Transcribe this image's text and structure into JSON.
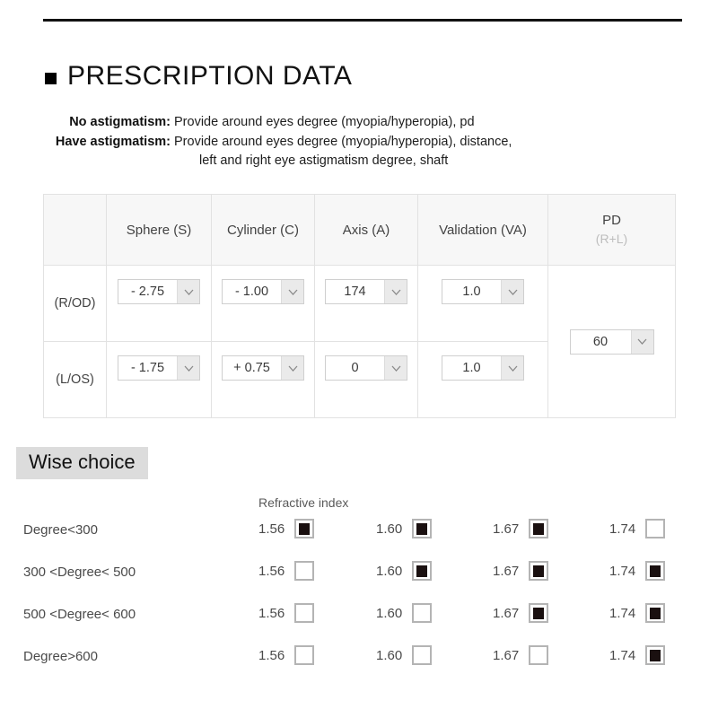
{
  "header": {
    "rule": true,
    "title": "PRESCRIPTION DATA",
    "bullet_icon": "black-square-bullet"
  },
  "notes": [
    {
      "label": "No astigmatism:",
      "line1": "Provide around eyes degree (myopia/hyperopia), pd",
      "line2": ""
    },
    {
      "label": "Have astigmatism:",
      "line1": "Provide around eyes degree (myopia/hyperopia), distance,",
      "line2": "left and right eye astigmatism degree, shaft"
    }
  ],
  "prescription_table": {
    "columns": [
      {
        "key": "eye",
        "label": ""
      },
      {
        "key": "sphere",
        "label": "Sphere (S)"
      },
      {
        "key": "cylinder",
        "label": "Cylinder (C)"
      },
      {
        "key": "axis",
        "label": "Axis (A)"
      },
      {
        "key": "validation",
        "label": "Validation (VA)"
      },
      {
        "key": "pd",
        "label": "PD",
        "sublabel": "(R+L)"
      }
    ],
    "rows": [
      {
        "eye": "(R/OD)",
        "sphere": "- 2.75",
        "cylinder": "- 1.00",
        "axis": "174",
        "validation": "1.0"
      },
      {
        "eye": "(L/OS)",
        "sphere": "- 1.75",
        "cylinder": "+ 0.75",
        "axis": "0",
        "validation": "1.0"
      }
    ],
    "pd_value": "60"
  },
  "wise_choice": {
    "heading": "Wise choice",
    "refractive_index_label": "Refractive index",
    "index_options": [
      "1.56",
      "1.60",
      "1.67",
      "1.74"
    ],
    "rows": [
      {
        "label": "Degree<300",
        "checked": [
          true,
          true,
          true,
          false
        ]
      },
      {
        "label": "300 <Degree< 500",
        "checked": [
          false,
          true,
          true,
          true
        ]
      },
      {
        "label": "500 <Degree< 600",
        "checked": [
          false,
          false,
          true,
          true
        ]
      },
      {
        "label": "Degree>600",
        "checked": [
          false,
          false,
          false,
          true
        ]
      }
    ]
  },
  "colors": {
    "rule": "#111111",
    "header_bg": "#f7f7f7",
    "border": "#e2e2e2",
    "highlight_bg": "#dcdcdc",
    "checkbox_border": "#b4b4b4",
    "checkbox_fill": "#1a1010",
    "muted_text": "#bdbdbd"
  }
}
